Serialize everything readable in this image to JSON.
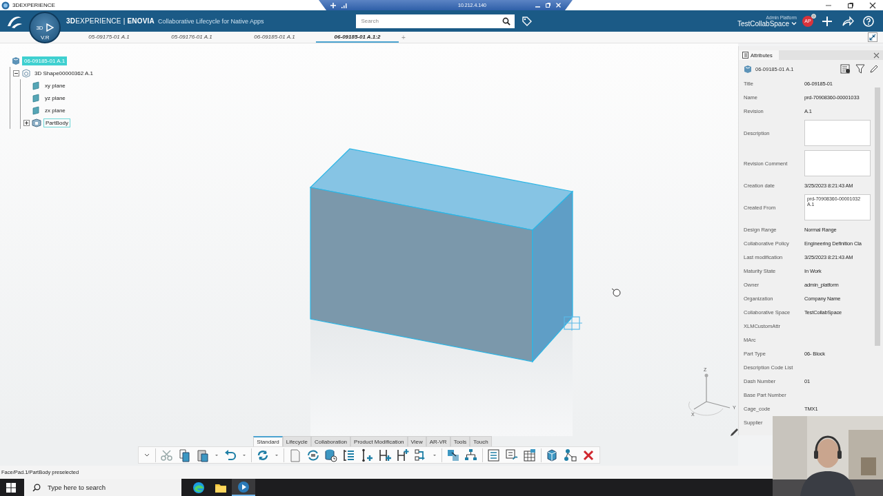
{
  "title_bar": {
    "app": "3DEXPERIENCE",
    "remote_host": "10.212.4.140"
  },
  "top_bar": {
    "compass_labels": [
      "3D",
      "V.R"
    ],
    "brand": "**3D**EXPERIENCE | **ENOVIA**",
    "app_name": "Collaborative Lifecycle for Native Apps",
    "search": {
      "placeholder": "Search"
    },
    "user": {
      "role": "Admin Platform",
      "space": "TestCollabSpace",
      "initials": "AP"
    }
  },
  "doc_tabs": [
    {
      "label": "05-09175-01 A.1",
      "selected": false
    },
    {
      "label": "05-09176-01 A.1",
      "selected": false
    },
    {
      "label": "06-09185-01 A.1",
      "selected": false
    },
    {
      "label": "06-09185-01 A.1:2",
      "selected": true
    }
  ],
  "new_tab": "+",
  "tree": [
    {
      "label": "06-09185-01 A.1",
      "kind": "product",
      "selected": true,
      "children": [
        {
          "label": "3D Shape00000362 A.1",
          "kind": "shape",
          "selected": false,
          "expanded": true,
          "children": [
            {
              "label": "xy plane",
              "kind": "plane",
              "selected": false
            },
            {
              "label": "yz plane",
              "kind": "plane",
              "selected": false
            },
            {
              "label": "zx plane",
              "kind": "plane",
              "selected": false
            },
            {
              "label": "PartBody",
              "kind": "body",
              "selected": false,
              "expanded": false,
              "preselected": true
            }
          ]
        }
      ]
    }
  ],
  "viewport": {
    "axis_labels": [
      "Z",
      "X",
      "Y"
    ]
  },
  "attributes": {
    "tab": "Attributes",
    "object": "06-09185-01 A.1",
    "rows": [
      {
        "label": "Title",
        "kind": "text",
        "value": "06-09185-01"
      },
      {
        "label": "Name",
        "kind": "text",
        "value": "prd-70908360-00001033"
      },
      {
        "label": "Revision",
        "kind": "text",
        "value": "A.1"
      },
      {
        "label": "Description",
        "kind": "box"
      },
      {
        "label": "Revision Comment",
        "kind": "box"
      },
      {
        "label": "Creation date",
        "kind": "text",
        "value": "3/25/2023 8:21:43 AM"
      },
      {
        "label": "Created From",
        "kind": "box",
        "value": "prd-70908360-00001032\nA.1"
      },
      {
        "label": "Design Range",
        "kind": "text",
        "value": "Normal Range"
      },
      {
        "label": "Collaborative Policy",
        "kind": "text",
        "value": "Engineering Definition Cla"
      },
      {
        "label": "Last modification",
        "kind": "text",
        "value": "3/25/2023 8:21:43 AM"
      },
      {
        "label": "Maturity State",
        "kind": "text",
        "value": "In Work"
      },
      {
        "label": "Owner",
        "kind": "text",
        "value": "admin_platform"
      },
      {
        "label": "Organization",
        "kind": "text",
        "value": "Company Name"
      },
      {
        "label": "Collaborative Space",
        "kind": "text",
        "value": "TestCollabSpace"
      },
      {
        "label": "XLMCustomAttr",
        "kind": "text"
      },
      {
        "label": "MArc",
        "kind": "text"
      },
      {
        "label": "Part Type",
        "kind": "text",
        "value": "06- Block"
      },
      {
        "label": "Description Code List",
        "kind": "text"
      },
      {
        "label": "Dash Number",
        "kind": "text",
        "value": "01"
      },
      {
        "label": "Base Part Number",
        "kind": "text"
      },
      {
        "label": "Cage_code",
        "kind": "text",
        "value": "TMX1"
      },
      {
        "label": "Supplier",
        "kind": "text"
      }
    ]
  },
  "command_tabs": [
    {
      "label": "Standard",
      "selected": true
    },
    {
      "label": "Lifecycle",
      "selected": false
    },
    {
      "label": "Collaboration",
      "selected": false
    },
    {
      "label": "Product Modification",
      "selected": false
    },
    {
      "label": "View",
      "selected": false
    },
    {
      "label": "AR-VR",
      "selected": false
    },
    {
      "label": "Tools",
      "selected": false
    },
    {
      "label": "Touch",
      "selected": false
    }
  ],
  "status_text": "Face/Pad.1/PartBody preselected",
  "taskbar": {
    "search_placeholder": "Type here to search"
  }
}
